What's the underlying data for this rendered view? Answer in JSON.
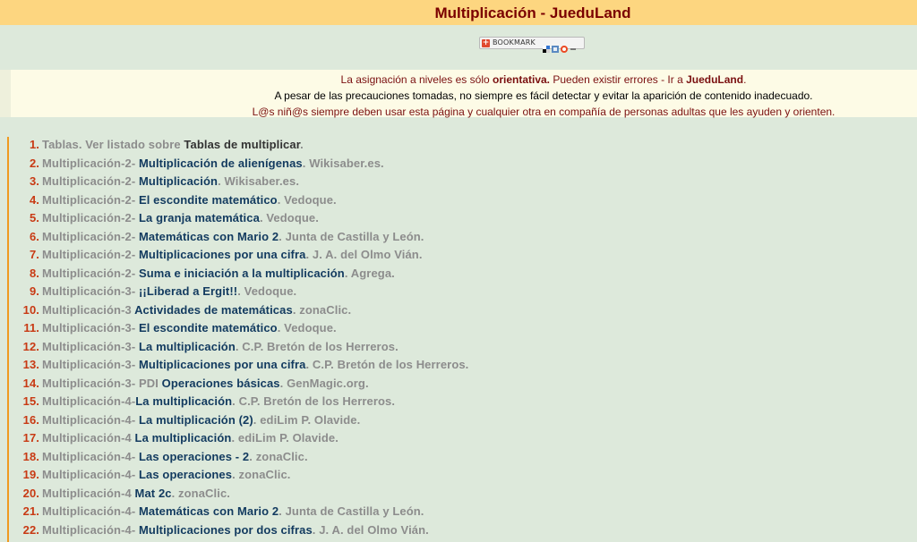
{
  "title": "Multiplicación - JueduLand",
  "bookmark": {
    "label": "BOOKMARK"
  },
  "notice": {
    "line1_prefix": "La asignación a niveles es sólo ",
    "line1_bold": "orientativa.",
    "line1_mid": " Pueden existir errores -  Ir a ",
    "line1_link": "JueduLand",
    "line1_end": ".",
    "line2": "A pesar de las precauciones tomadas, no siempre es fácil detectar y evitar la aparición de contenido inadecuado.",
    "line3": "L@s niñ@s siempre deben usar esta página y cualquier otra en compañía de personas adultas que les ayuden y orienten."
  },
  "items": [
    {
      "num": "1.",
      "pre": "Tablas. Ver listado sobre ",
      "link": "Tablas de multiplicar",
      "post": "."
    },
    {
      "num": "2.",
      "pre": "Multiplicación-2- ",
      "link": "Multiplicación de alienígenas",
      "post": ". Wikisaber.es."
    },
    {
      "num": "3.",
      "pre": "Multiplicación-2- ",
      "link": "Multiplicación",
      "post": ". Wikisaber.es."
    },
    {
      "num": "4.",
      "pre": "Multiplicación-2- ",
      "link": "El escondite matemático",
      "post": ". Vedoque."
    },
    {
      "num": "5.",
      "pre": "Multiplicación-2- ",
      "link": "La granja matemática",
      "post": ". Vedoque."
    },
    {
      "num": "6.",
      "pre": "Multiplicación-2- ",
      "link": "Matemáticas con Mario 2",
      "post": ". Junta de Castilla y León."
    },
    {
      "num": "7.",
      "pre": "Multiplicación-2- ",
      "link": "Multiplicaciones por una cifra",
      "post": ". J. A. del Olmo Vián."
    },
    {
      "num": "8.",
      "pre": "Multiplicación-2- ",
      "link": "Suma e iniciación a la multiplicación",
      "post": ". Agrega."
    },
    {
      "num": "9.",
      "pre": "Multiplicación-3- ",
      "link": "¡¡Liberad a Ergit!!",
      "post": ". Vedoque."
    },
    {
      "num": "10.",
      "pre": "Multiplicación-3 ",
      "link": "Actividades de matemáticas",
      "post": ". zonaClic."
    },
    {
      "num": "11.",
      "pre": "Multiplicación-3- ",
      "link": "El escondite matemático",
      "post": ". Vedoque."
    },
    {
      "num": "12.",
      "pre": "Multiplicación-3- ",
      "link": "La multiplicación",
      "post": ". C.P. Bretón de los Herreros."
    },
    {
      "num": "13.",
      "pre": "Multiplicación-3- ",
      "link": "Multiplicaciones por una cifra",
      "post": ". C.P. Bretón de los Herreros."
    },
    {
      "num": "14.",
      "pre": "Multiplicación-3- PDI ",
      "link": "Operaciones básicas",
      "post": ". GenMagic.org."
    },
    {
      "num": "15.",
      "pre": "Multiplicación-4-",
      "link": "La multiplicación",
      "post": ". C.P. Bretón de los Herreros."
    },
    {
      "num": "16.",
      "pre": "Multiplicación-4- ",
      "link": "La multiplicación (2)",
      "post": ". ediLim P. Olavide."
    },
    {
      "num": "17.",
      "pre": "Multiplicación-4 ",
      "link": "La multiplicación",
      "post": ". ediLim P. Olavide."
    },
    {
      "num": "18.",
      "pre": "Multiplicación-4- ",
      "link": "Las operaciones - 2",
      "post": ". zonaClic."
    },
    {
      "num": "19.",
      "pre": "Multiplicación-4- ",
      "link": "Las operaciones",
      "post": ". zonaClic."
    },
    {
      "num": "20.",
      "pre": "Multiplicación-4 ",
      "link": "Mat 2c",
      "post": ". zonaClic."
    },
    {
      "num": "21.",
      "pre": "Multiplicación-4- ",
      "link": "Matemáticas con Mario 2",
      "post": ". Junta de Castilla y León."
    },
    {
      "num": "22.",
      "pre": "Multiplicación-4- ",
      "link": "Multiplicaciones por dos cifras",
      "post": ". J. A. del Olmo Vián."
    }
  ]
}
